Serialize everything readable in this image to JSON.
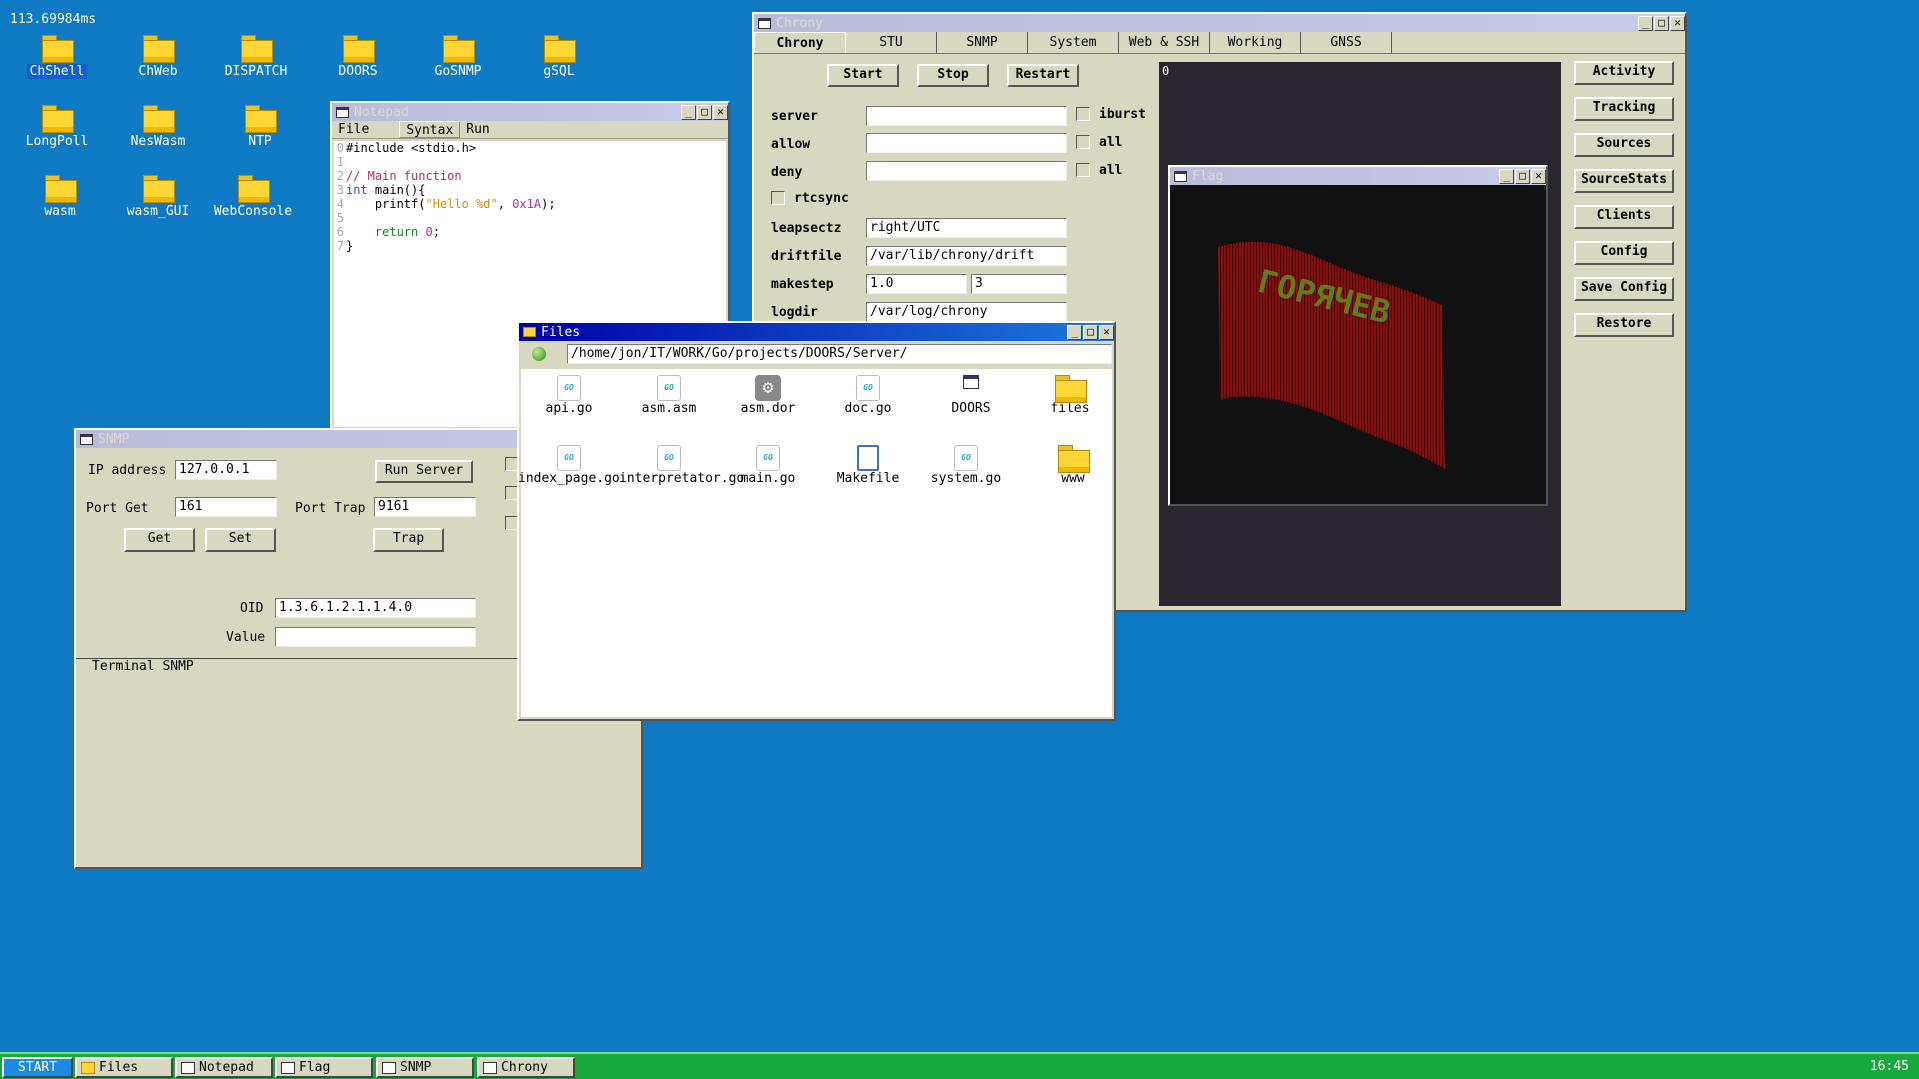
{
  "fps": "113.69984ms",
  "desktop": {
    "icons": [
      "ChShell",
      "ChWeb",
      "DISPATCH",
      "DOORS",
      "GoSNMP",
      "gSQL",
      "LongPoll",
      "NesWasm",
      "NTP",
      "wasm",
      "wasm_GUI",
      "WebConsole"
    ]
  },
  "notepad": {
    "title": "Notepad",
    "menu": [
      "File",
      "Syntax",
      "Run"
    ],
    "line_numbers": [
      "0",
      "1",
      "2",
      "3",
      "4",
      "5",
      "6",
      "7"
    ],
    "code": {
      "l0": "#include <stdio.h>",
      "l2": "// Main function",
      "l3_kw": "int",
      "l3_rest": " main(){",
      "l4_a": "    printf(",
      "l4_str": "\"Hello %d\"",
      "l4_b": ", ",
      "l4_num": "0x1A",
      "l4_c": ");",
      "l6_kw": "    return",
      "l6_sp": " ",
      "l6_num": "0",
      "l6_end": ";",
      "l7": "}"
    }
  },
  "snmp": {
    "title": "SNMP",
    "ip_label": "IP address",
    "ip_value": "127.0.0.1",
    "run_server": "Run Server",
    "port_get_label": "Port Get",
    "port_get_value": "161",
    "port_trap_label": "Port Trap",
    "port_trap_value": "9161",
    "get": "Get",
    "set": "Set",
    "trap": "Trap",
    "oid_label": "OID",
    "oid_value": "1.3.6.1.2.1.1.4.0",
    "value_label": "Value",
    "value_value": "",
    "terminal": "Terminal SNMP"
  },
  "chrony": {
    "title": "Chrony",
    "tabs": [
      "Chrony",
      "STU",
      "SNMP",
      "System",
      "Web & SSH",
      "Working",
      "GNSS"
    ],
    "start": "Start",
    "stop": "Stop",
    "restart": "Restart",
    "server_label": "server",
    "iburst": "iburst",
    "allow_label": "allow",
    "all1": "all",
    "deny_label": "deny",
    "all2": "all",
    "rtcsync": "rtcsync",
    "leapsectz_label": "leapsectz",
    "leapsectz_value": "right/UTC",
    "driftfile_label": "driftfile",
    "driftfile_value": "/var/lib/chrony/drift",
    "makestep_label": "makestep",
    "makestep_a": "1.0",
    "makestep_b": "3",
    "logdir_label": "logdir",
    "logdir_value": "/var/log/chrony",
    "console_text": "0",
    "side_buttons": [
      "Activity",
      "Tracking",
      "Sources",
      "SourceStats",
      "Clients",
      "Config",
      "Save Config",
      "Restore"
    ]
  },
  "flag": {
    "title": "Flag",
    "text": "ГОРЯЧЕВ",
    "colors": {
      "flag": "#7a0c0c",
      "text": "#6a8a20"
    }
  },
  "files": {
    "title": "Files",
    "path": "/home/jon/IT/WORK/Go/projects/DOORS/Server/",
    "items": [
      "api.go",
      "asm.asm",
      "asm.dor",
      "doc.go",
      "DOORS",
      "files",
      "index_page.go",
      "interpretator.go",
      "main.go",
      "Makefile",
      "system.go",
      "www"
    ],
    "go_badge": "GO"
  },
  "taskbar": {
    "start": "START",
    "items": [
      "Files",
      "Notepad",
      "Flag",
      "SNMP",
      "Chrony"
    ],
    "clock": "16:45"
  },
  "colors": {
    "desktop": "#0f7ac4",
    "taskbar": "#17a93b",
    "window": "#d8d8c0",
    "active_title": "#0000a8"
  }
}
